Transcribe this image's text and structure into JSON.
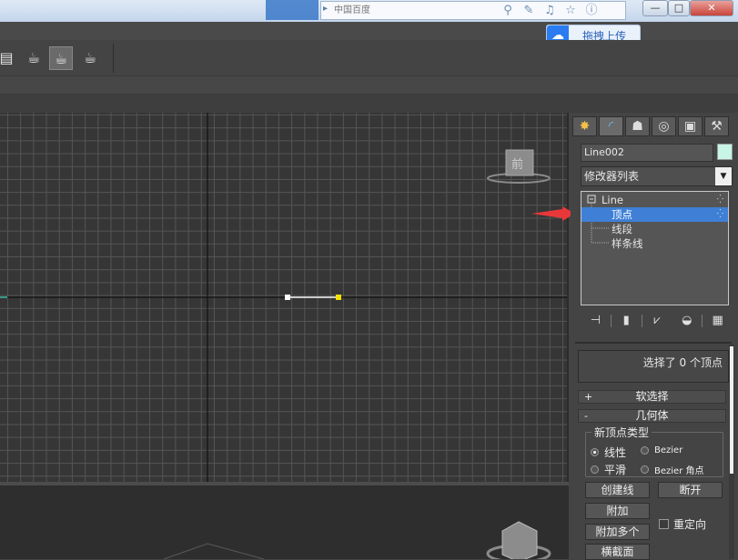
{
  "browser": {
    "address_placeholder": "中国百度",
    "tool_icons": [
      "binoculars-icon",
      "wrench-icon",
      "bell-icon",
      "star-icon",
      "info-icon"
    ],
    "window_buttons": [
      "—",
      "□",
      "✕"
    ]
  },
  "upload": {
    "label": "拖拽上传",
    "icon": "cloud-icon"
  },
  "toolbar": {
    "buttons": [
      "render-frame-icon",
      "teapot-render-setup-icon",
      "teapot-render-icon",
      "teapot-quick-render-icon"
    ]
  },
  "viewport": {
    "label": "前",
    "grid": true,
    "line_object": "Line002"
  },
  "panel": {
    "tabs": [
      "create-icon",
      "modify-icon",
      "hierarchy-icon",
      "motion-icon",
      "display-icon",
      "utilities-icon"
    ],
    "object_name": "Line002",
    "object_color": "#c8f5e6",
    "modifier_list": "修改器列表",
    "stack": {
      "root": "Line",
      "items": [
        "顶点",
        "线段",
        "样条线"
      ],
      "selected_index": 0
    },
    "selection_text": "选择了 0 个顶点",
    "rollouts": {
      "soft_selection": "软选择",
      "soft_selection_sign": "+",
      "geometry": "几何体",
      "geometry_sign": "-"
    },
    "new_vertex_type": {
      "legend": "新顶点类型",
      "options": [
        "线性",
        "Bezier",
        "平滑",
        "Bezier 角点"
      ],
      "selected": "线性"
    },
    "buttons": {
      "create_line": "创建线",
      "break": "断开",
      "attach": "附加",
      "attach_multiple": "附加多个",
      "cross_section": "横截面"
    },
    "reorient_label": "重定向"
  },
  "colors": {
    "selection_blue": "#3f80d6",
    "annotation_red": "#e8383a",
    "vertex_yellow": "#f5e100"
  }
}
